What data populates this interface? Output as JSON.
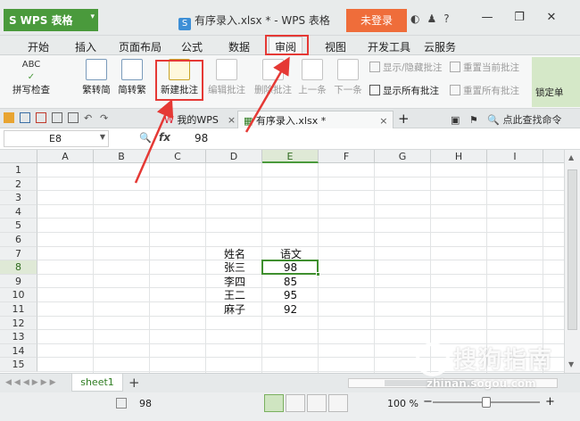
{
  "titlebar": {
    "app_name": "WPS 表格",
    "app_logo": "S",
    "document_title": "有序录入.xlsx * - WPS 表格",
    "login_label": "未登录",
    "icons": [
      "theme-icon",
      "skin-icon",
      "help-icon",
      "minimize-icon",
      "restore-icon",
      "close-icon"
    ],
    "help_glyph": "?"
  },
  "menu": {
    "tabs": [
      "开始",
      "插入",
      "页面布局",
      "公式",
      "数据",
      "审阅",
      "视图",
      "开发工具",
      "云服务"
    ],
    "active": "审阅"
  },
  "ribbon": {
    "spell_check_icon_text": "ABC",
    "spell_check": "拼写检查",
    "trad_simplified": "繁转简",
    "simplified_trad": "简转繁",
    "new_comment": "新建批注",
    "edit_comment": "编辑批注",
    "delete_comment": "删除批注",
    "prev": "上一条",
    "next": "下一条",
    "show_hide_comment": "显示/隐藏批注",
    "reset_current_comment": "重置当前批注",
    "show_all_comments": "显示所有批注",
    "reset_all_comments": "重置所有批注",
    "lock_cell": "锁定单"
  },
  "doctabs": {
    "tabs": [
      {
        "label": "我的WPS",
        "icon": "wps-icon"
      },
      {
        "label": "有序录入.xlsx *",
        "icon": "sheet-file-icon"
      }
    ],
    "add": "+",
    "close": "×",
    "search_label": "点此查找命令"
  },
  "formula_bar": {
    "name_box": "E8",
    "fx": "fx",
    "value": "98"
  },
  "grid": {
    "columns": [
      "A",
      "B",
      "C",
      "D",
      "E",
      "F",
      "G",
      "H",
      "I"
    ],
    "rows": [
      "1",
      "2",
      "3",
      "4",
      "5",
      "6",
      "7",
      "8",
      "9",
      "10",
      "11",
      "12",
      "13",
      "14",
      "15"
    ],
    "selected_column": "E",
    "selected_row": "8",
    "data": {
      "header": [
        "姓名",
        "语文"
      ],
      "rows": [
        [
          "张三",
          "98"
        ],
        [
          "李四",
          "85"
        ],
        [
          "王二",
          "95"
        ],
        [
          "麻子",
          "92"
        ]
      ]
    }
  },
  "sheets": {
    "tabs": [
      "sheet1"
    ],
    "add": "+"
  },
  "status": {
    "value": "98",
    "zoom": "100 %",
    "zoom_minus": "−",
    "zoom_plus": "+",
    "zoom_level": 0.5
  },
  "watermark": {
    "text": "搜狗指南",
    "url": "zhinan.sogou.com"
  },
  "annotation_color": "#e53935",
  "accent_color": "#4a9a3c"
}
